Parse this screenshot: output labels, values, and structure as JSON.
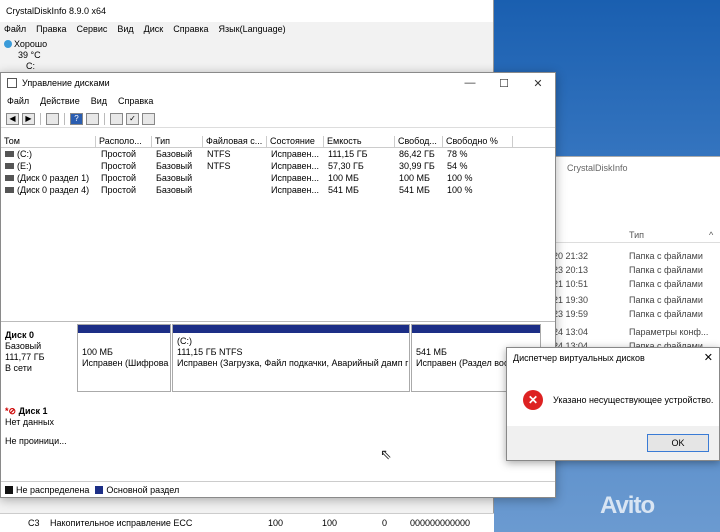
{
  "cdi": {
    "title": "CrystalDiskInfo 8.9.0 x64",
    "menu": [
      "Файл",
      "Правка",
      "Сервис",
      "Вид",
      "Диск",
      "Справка",
      "Язык(Language)"
    ],
    "health": "Хорошо",
    "temp": "39 °C",
    "drive": "C:",
    "bottom_row": {
      "id": "C3",
      "name": "Накопительное исправление ECC",
      "v1": "100",
      "v2": "100",
      "v3": "0",
      "raw": "000000000000"
    }
  },
  "cdi2": {
    "title": "CrystalDiskInfo",
    "col_type": "Тип",
    "rows": [
      {
        "date": "20 21:32",
        "type": "Папка с файлами"
      },
      {
        "date": "23 20:13",
        "type": "Папка с файлами"
      },
      {
        "date": "21 10:51",
        "type": "Папка с файлами"
      },
      {
        "date": "21 19:30",
        "type": "Папка с файлами"
      },
      {
        "date": "23 19:59",
        "type": "Папка с файлами"
      },
      {
        "date": "24 13:04",
        "type": "Параметры конф..."
      },
      {
        "date": "24 13:04",
        "type": "Папка с файлами"
      }
    ]
  },
  "dm": {
    "title": "Управление дисками",
    "menu": [
      "Файл",
      "Действие",
      "Вид",
      "Справка"
    ],
    "columns": [
      "Том",
      "Располо...",
      "Тип",
      "Файловая с...",
      "Состояние",
      "Емкость",
      "Свобод...",
      "Свободно %"
    ],
    "volumes": [
      [
        "(C:)",
        "Простой",
        "Базовый",
        "NTFS",
        "Исправен...",
        "111,15 ГБ",
        "86,42 ГБ",
        "78 %"
      ],
      [
        "(E:)",
        "Простой",
        "Базовый",
        "NTFS",
        "Исправен...",
        "57,30 ГБ",
        "30,99 ГБ",
        "54 %"
      ],
      [
        "(Диск 0 раздел 1)",
        "Простой",
        "Базовый",
        "",
        "Исправен...",
        "100 МБ",
        "100 МБ",
        "100 %"
      ],
      [
        "(Диск 0 раздел 4)",
        "Простой",
        "Базовый",
        "",
        "Исправен...",
        "541 МБ",
        "541 МБ",
        "100 %"
      ]
    ],
    "disk0": {
      "name": "Диск 0",
      "type": "Базовый",
      "size": "111,77 ГБ",
      "status": "В сети"
    },
    "partitions": [
      {
        "l1": "",
        "l2": "100 МБ",
        "l3": "Исправен (Шифрова"
      },
      {
        "l1": "(C:)",
        "l2": "111,15 ГБ NTFS",
        "l3": "Исправен (Загрузка, Файл подкачки, Аварийный дамп г"
      },
      {
        "l1": "",
        "l2": "541 МБ",
        "l3": "Исправен (Раздел вос"
      }
    ],
    "disk1": {
      "name": "Диск 1",
      "status": "Нет данных",
      "init": "Не проиници..."
    },
    "legend": {
      "unalloc": "Не распределена",
      "primary": "Основной раздел",
      "unalloc_color": "#111111",
      "primary_color": "#1c2e86"
    }
  },
  "dialog": {
    "title": "Диспетчер виртуальных дисков",
    "message": "Указано несуществующее устройство.",
    "ok": "OK"
  },
  "watermark": "Avito"
}
